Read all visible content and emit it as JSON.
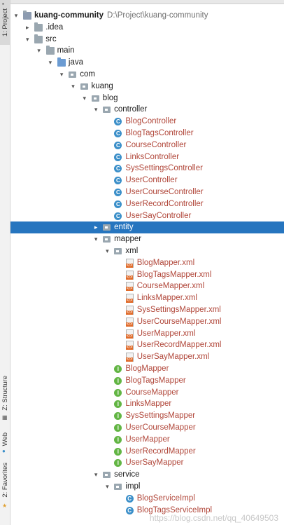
{
  "sidebar": {
    "project_tab": "1: Project",
    "structure_tab": "Z: Structure",
    "web_tab": "Web",
    "favorites_tab": "2: Favorites"
  },
  "tree": [
    {
      "label": "kuang-community",
      "path": "D:\\Project\\kuang-community",
      "icon": "module-folder-icon",
      "depth": 0,
      "expanded": true,
      "bold": true
    },
    {
      "label": ".idea",
      "icon": "folder-icon",
      "depth": 1,
      "expanded": false
    },
    {
      "label": "src",
      "icon": "folder-icon",
      "depth": 1,
      "expanded": true
    },
    {
      "label": "main",
      "icon": "folder-icon",
      "depth": 2,
      "expanded": true
    },
    {
      "label": "java",
      "icon": "source-folder-icon",
      "depth": 3,
      "expanded": true
    },
    {
      "label": "com",
      "icon": "package-icon",
      "depth": 4,
      "expanded": true
    },
    {
      "label": "kuang",
      "icon": "package-icon",
      "depth": 5,
      "expanded": true
    },
    {
      "label": "blog",
      "icon": "package-icon",
      "depth": 6,
      "expanded": true
    },
    {
      "label": "controller",
      "icon": "package-icon",
      "depth": 7,
      "expanded": true
    },
    {
      "label": "BlogController",
      "icon": "class-icon",
      "depth": 8,
      "red": true
    },
    {
      "label": "BlogTagsController",
      "icon": "class-icon",
      "depth": 8,
      "red": true
    },
    {
      "label": "CourseController",
      "icon": "class-icon",
      "depth": 8,
      "red": true
    },
    {
      "label": "LinksController",
      "icon": "class-icon",
      "depth": 8,
      "red": true
    },
    {
      "label": "SysSettingsController",
      "icon": "class-icon",
      "depth": 8,
      "red": true
    },
    {
      "label": "UserController",
      "icon": "class-icon",
      "depth": 8,
      "red": true
    },
    {
      "label": "UserCourseController",
      "icon": "class-icon",
      "depth": 8,
      "red": true
    },
    {
      "label": "UserRecordController",
      "icon": "class-icon",
      "depth": 8,
      "red": true
    },
    {
      "label": "UserSayController",
      "icon": "class-icon",
      "depth": 8,
      "red": true
    },
    {
      "label": "entity",
      "icon": "package-icon",
      "depth": 7,
      "expanded": false,
      "selected": true
    },
    {
      "label": "mapper",
      "icon": "package-icon",
      "depth": 7,
      "expanded": true
    },
    {
      "label": "xml",
      "icon": "package-icon",
      "depth": 8,
      "expanded": true
    },
    {
      "label": "BlogMapper.xml",
      "icon": "xml-file-icon",
      "depth": 9,
      "red": true
    },
    {
      "label": "BlogTagsMapper.xml",
      "icon": "xml-file-icon",
      "depth": 9,
      "red": true
    },
    {
      "label": "CourseMapper.xml",
      "icon": "xml-file-icon",
      "depth": 9,
      "red": true
    },
    {
      "label": "LinksMapper.xml",
      "icon": "xml-file-icon",
      "depth": 9,
      "red": true
    },
    {
      "label": "SysSettingsMapper.xml",
      "icon": "xml-file-icon",
      "depth": 9,
      "red": true
    },
    {
      "label": "UserCourseMapper.xml",
      "icon": "xml-file-icon",
      "depth": 9,
      "red": true
    },
    {
      "label": "UserMapper.xml",
      "icon": "xml-file-icon",
      "depth": 9,
      "red": true
    },
    {
      "label": "UserRecordMapper.xml",
      "icon": "xml-file-icon",
      "depth": 9,
      "red": true
    },
    {
      "label": "UserSayMapper.xml",
      "icon": "xml-file-icon",
      "depth": 9,
      "red": true
    },
    {
      "label": "BlogMapper",
      "icon": "interface-icon",
      "depth": 8,
      "red": true
    },
    {
      "label": "BlogTagsMapper",
      "icon": "interface-icon",
      "depth": 8,
      "red": true
    },
    {
      "label": "CourseMapper",
      "icon": "interface-icon",
      "depth": 8,
      "red": true
    },
    {
      "label": "LinksMapper",
      "icon": "interface-icon",
      "depth": 8,
      "red": true
    },
    {
      "label": "SysSettingsMapper",
      "icon": "interface-icon",
      "depth": 8,
      "red": true
    },
    {
      "label": "UserCourseMapper",
      "icon": "interface-icon",
      "depth": 8,
      "red": true
    },
    {
      "label": "UserMapper",
      "icon": "interface-icon",
      "depth": 8,
      "red": true
    },
    {
      "label": "UserRecordMapper",
      "icon": "interface-icon",
      "depth": 8,
      "red": true
    },
    {
      "label": "UserSayMapper",
      "icon": "interface-icon",
      "depth": 8,
      "red": true
    },
    {
      "label": "service",
      "icon": "package-icon",
      "depth": 7,
      "expanded": true
    },
    {
      "label": "impl",
      "icon": "package-icon",
      "depth": 8,
      "expanded": true
    },
    {
      "label": "BlogServiceImpl",
      "icon": "class-icon",
      "depth": 9,
      "red": true
    },
    {
      "label": "BlogTagsServiceImpl",
      "icon": "class-icon",
      "depth": 9,
      "red": true
    }
  ],
  "watermark": "https://blog.csdn.net/qq_40649503",
  "colors": {
    "selection": "#2675bf",
    "unversioned_text": "#b1473a",
    "class_icon": "#3b8fc9",
    "interface_icon": "#62b543"
  }
}
